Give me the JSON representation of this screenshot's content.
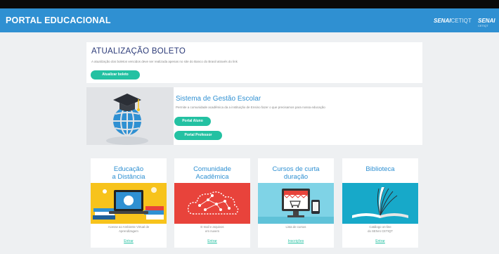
{
  "header": {
    "title": "PORTAL EDUCACIONAL",
    "logo1_main": "SENAI",
    "logo1_sub": "CETIQT",
    "logo2_main": "SENAI",
    "logo2_sub": "CETIQT"
  },
  "boleto": {
    "title": "ATUALIZAÇÃO BOLETO",
    "description": "A atualização dos boletos vencidos deve ser realizada apenas no site do Banco do Brasil através do link",
    "button": "Atualizar boleto"
  },
  "sge": {
    "title": "Sistema de Gestão Escolar",
    "description": "Permite a comunidade acadêmica da a instituição de Ensino fazer o que precisamos para nossa educação",
    "button_aluno": "Portal Aluno",
    "button_professor": "Portal Professor"
  },
  "tiles": [
    {
      "title_l1": "Educação",
      "title_l2": "a Distância",
      "desc_l1": "Acesse ao Ambiente Virtual de",
      "desc_l2": "Aprendizagem",
      "link": "Entrar",
      "color": "#f7c31c"
    },
    {
      "title_l1": "Comunidade",
      "title_l2": "Acadêmica",
      "desc_l1": "E-mail e arquivos",
      "desc_l2": "em nuvem",
      "link": "Entrar",
      "color": "#e8433b"
    },
    {
      "title_l1": "Cursos de curta",
      "title_l2": "duração",
      "desc_l1": "Lista de cursos",
      "desc_l2": "",
      "link": "Inscrições",
      "color": "#7fd3e6"
    },
    {
      "title_l1": "Biblioteca",
      "title_l2": "",
      "desc_l1": "Catálogo on-line",
      "desc_l2": "do SENAI CETIQT",
      "link": "Entrar",
      "color": "#17a9c9"
    }
  ]
}
